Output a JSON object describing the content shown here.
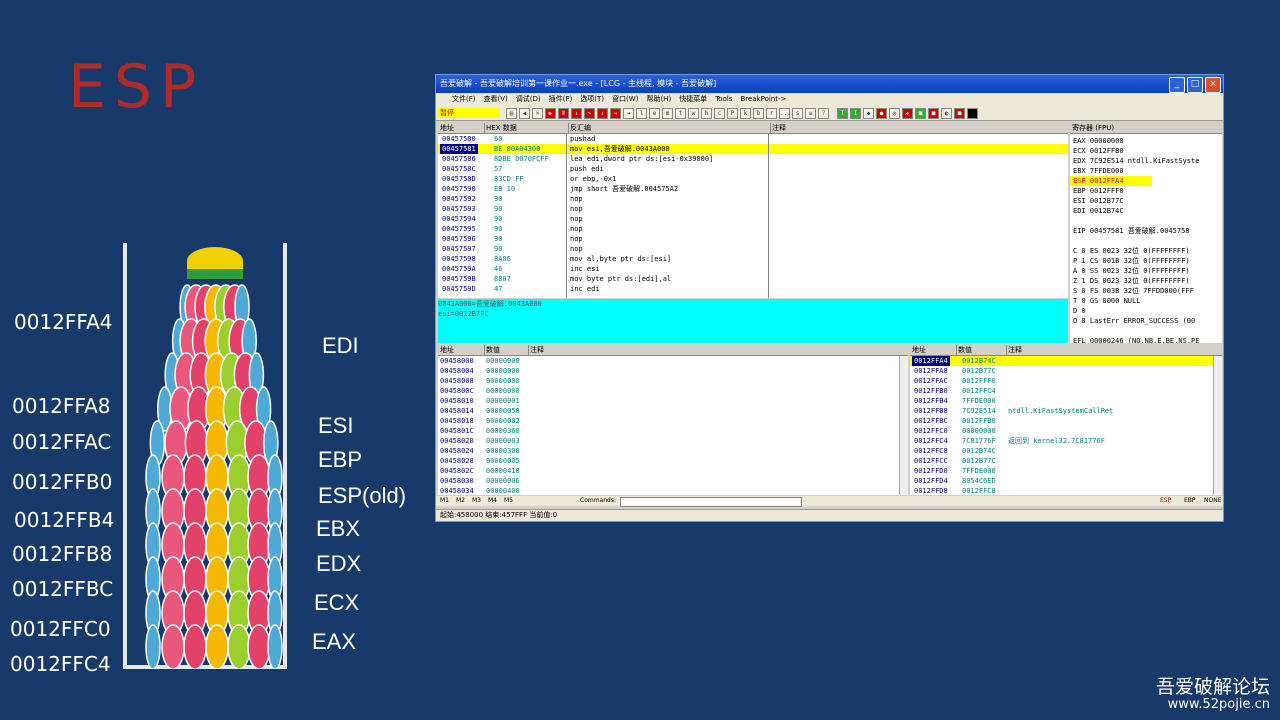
{
  "slide": {
    "title": "ESP",
    "addresses": [
      "0012FFA4",
      "0012FFA8",
      "0012FFAC",
      "0012FFB0",
      "0012FFB4",
      "0012FFB8",
      "0012FFBC",
      "0012FFC0",
      "0012FFC4"
    ],
    "registers": [
      "EDI",
      "ESI",
      "EBP",
      "ESP(old)",
      "EBX",
      "EDX",
      "ECX",
      "EAX"
    ],
    "watermark": "吾爱破解论坛",
    "watermark_url": "www.52pojie.cn",
    "colors": {
      "background": "#173a6a",
      "title": "#b02a2a",
      "shuttle_cap": "#f2d000",
      "shuttle_band": "#2e9e3a"
    }
  },
  "olly": {
    "title": "吾爱破解 - 吾爱破解培训第一课作业一.exe - [LCG - 主线程, 模块 - 吾爱破解]",
    "menu": [
      "文件(F)",
      "查看(V)",
      "调试(D)",
      "插件(P)",
      "选项(T)",
      "窗口(W)",
      "帮助(H)",
      "快捷菜单",
      "Tools",
      "BreakPoint->"
    ],
    "state": "暂停",
    "toolbar_letters": [
      "l",
      "e",
      "m",
      "t",
      "w",
      "h",
      "c",
      "P",
      "k",
      "b",
      "r",
      "...",
      "s"
    ],
    "disasm": {
      "headers": [
        "地址",
        "HEX 数据",
        "反汇编",
        "注释"
      ],
      "rows": [
        {
          "addr": "00457580",
          "hex": "60",
          "asm": "pushad"
        },
        {
          "addr": "00457581",
          "hex": "BE 00A04300",
          "asm": "mov esi,吾爱破解.0043A000"
        },
        {
          "addr": "00457586",
          "hex": "8DBE 0070FCFF",
          "asm": "lea edi,dword ptr ds:[esi-0x39000]"
        },
        {
          "addr": "0045758C",
          "hex": "57",
          "asm": "push edi"
        },
        {
          "addr": "0045758D",
          "hex": "83CD FF",
          "asm": "or ebp,-0x1"
        },
        {
          "addr": "00457590",
          "hex": "EB 10",
          "asm": "jmp short 吾爱破解.004575A2"
        },
        {
          "addr": "00457592",
          "hex": "90",
          "asm": "nop"
        },
        {
          "addr": "00457593",
          "hex": "90",
          "asm": "nop"
        },
        {
          "addr": "00457594",
          "hex": "90",
          "asm": "nop"
        },
        {
          "addr": "00457595",
          "hex": "90",
          "asm": "nop"
        },
        {
          "addr": "00457596",
          "hex": "90",
          "asm": "nop"
        },
        {
          "addr": "00457597",
          "hex": "90",
          "asm": "nop"
        },
        {
          "addr": "00457598",
          "hex": "8A06",
          "asm": "mov al,byte ptr ds:[esi]"
        },
        {
          "addr": "0045759A",
          "hex": "46",
          "asm": "inc esi"
        },
        {
          "addr": "0045759B",
          "hex": "8807",
          "asm": "mov byte ptr ds:[edi],al"
        },
        {
          "addr": "0045759D",
          "hex": "47",
          "asm": "inc edi"
        }
      ],
      "info": [
        "0043A000=吾爱破解.0043A000",
        "esi=0012B77C"
      ]
    },
    "registers": {
      "header": "寄存器 (FPU)",
      "lines": [
        "EAX 00000000",
        "ECX 0012FFB0",
        "EDX 7C92E514 ntdll.KiFastSyste",
        "EBX 7FFDE000",
        "ESP 0012FFA4",
        "EBP 0012FFF0",
        "ESI 0012B77C",
        "EDI 0012B74C",
        "",
        "EIP 00457581 吾爱破解.0045758",
        "",
        "C 0  ES 0023 32位 0(FFFFFFFF)",
        "P 1  CS 001B 32位 0(FFFFFFFF)",
        "A 0  SS 0023 32位 0(FFFFFFFF)",
        "Z 1  DS 0023 32位 0(FFFFFFFF)",
        "S 0  FS 003B 32位 7FFDD000(FFF",
        "T 0  GS 0000 NULL",
        "D 0",
        "O 0  LastErr ERROR_SUCCESS (00",
        "",
        "EFL 00000246 (NO,NB,E,BE,NS,PE"
      ]
    },
    "dump": {
      "headers": [
        "地址",
        "数值",
        "注释"
      ],
      "rows": [
        [
          "00458000",
          "00000000"
        ],
        [
          "00458004",
          "00000000"
        ],
        [
          "00458008",
          "00000000"
        ],
        [
          "0045800C",
          "00000000"
        ],
        [
          "00458010",
          "00000001"
        ],
        [
          "00458014",
          "00000058"
        ],
        [
          "00458018",
          "00000002"
        ],
        [
          "0045801C",
          "00000360"
        ],
        [
          "00458020",
          "00000003"
        ],
        [
          "00458024",
          "00000308"
        ],
        [
          "00458028",
          "00000005"
        ],
        [
          "0045802C",
          "00000418"
        ],
        [
          "00458030",
          "00000006"
        ],
        [
          "00458034",
          "00000408"
        ]
      ]
    },
    "stack": {
      "headers": [
        "地址",
        "数值",
        "注释"
      ],
      "rows": [
        [
          "0012FFA4",
          "0012B74C",
          ""
        ],
        [
          "0012FFA8",
          "0012B77C",
          ""
        ],
        [
          "0012FFAC",
          "0012FFF0",
          ""
        ],
        [
          "0012FFB0",
          "0012FFC4",
          ""
        ],
        [
          "0012FFB4",
          "7FFDE000",
          ""
        ],
        [
          "0012FFB8",
          "7C92E514",
          "ntdll.KiFastSystemCallRet"
        ],
        [
          "0012FFBC",
          "0012FFB0",
          ""
        ],
        [
          "0012FFC0",
          "00000000",
          ""
        ],
        [
          "0012FFC4",
          "7C81776F",
          "返回到 kernel32.7C81776F"
        ],
        [
          "0012FFC8",
          "0012B74C",
          ""
        ],
        [
          "0012FFCC",
          "0012B77C",
          ""
        ],
        [
          "0012FFD0",
          "7FFDE000",
          ""
        ],
        [
          "0012FFD4",
          "8054C6ED",
          ""
        ],
        [
          "0012FFD8",
          "0012FFC8",
          ""
        ]
      ]
    },
    "bottom_tabs": [
      "M1",
      "M2",
      "M3",
      "M4",
      "M5"
    ],
    "commands_label": "Commands:",
    "bottom_right": [
      "ESP",
      "EBP",
      "NONE"
    ],
    "status": "起始:458000 结束:457FFF 当前值:0"
  }
}
